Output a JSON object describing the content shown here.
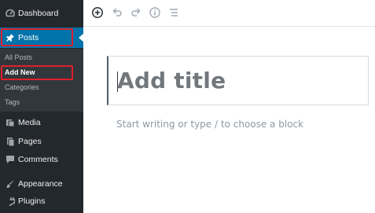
{
  "sidebar": {
    "dashboard": {
      "label": "Dashboard",
      "icon": "dashboard-icon"
    },
    "posts": {
      "label": "Posts",
      "icon": "pushpin-icon"
    },
    "submenu": {
      "all_posts": "All Posts",
      "add_new": "Add New",
      "categories": "Categories",
      "tags": "Tags"
    },
    "media": {
      "label": "Media",
      "icon": "media-icon"
    },
    "pages": {
      "label": "Pages",
      "icon": "pages-icon"
    },
    "comments": {
      "label": "Comments",
      "icon": "comment-icon"
    },
    "appearance": {
      "label": "Appearance",
      "icon": "paintbrush-icon"
    },
    "plugins": {
      "label": "Plugins",
      "icon": "plugin-icon"
    }
  },
  "toolbar": {
    "icons": [
      "add-block-icon",
      "undo-icon",
      "redo-icon",
      "info-icon",
      "block-navigation-icon"
    ]
  },
  "editor": {
    "title_placeholder": "Add title",
    "body_placeholder": "Start writing or type / to choose a block"
  },
  "colors": {
    "sidebar_bg": "#23282d",
    "submenu_bg": "#32373c",
    "active_blue": "#0073aa",
    "highlight_red": "#e0202b"
  }
}
